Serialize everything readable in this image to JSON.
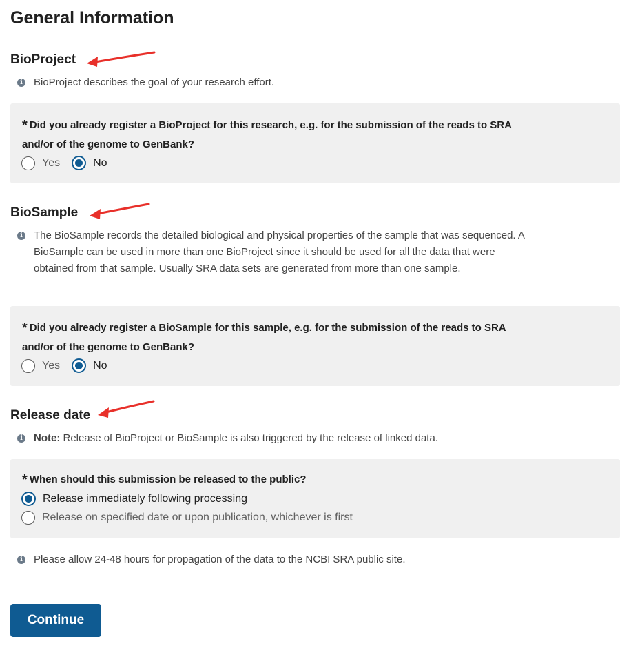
{
  "page_title": "General Information",
  "colors": {
    "accent": "#0f5b92",
    "panel_bg": "#f0f0f0",
    "annotation_arrow": "#e8302a"
  },
  "bioproject": {
    "heading": "BioProject",
    "info": "BioProject describes the goal of your research effort.",
    "question": "Did you already register a BioProject for this research, e.g. for the submission of the reads to SRA and/or of the genome to GenBank?",
    "options": [
      {
        "label": "Yes",
        "selected": false
      },
      {
        "label": "No",
        "selected": true
      }
    ]
  },
  "biosample": {
    "heading": "BioSample",
    "info": "The BioSample records the detailed biological and physical properties of the sample that was sequenced. A BioSample can be used in more than one BioProject since it should be used for all the data that were obtained from that sample. Usually SRA data sets are generated from more than one sample.",
    "question": "Did you already register a BioSample for this sample, e.g. for the submission of the reads to SRA and/or of the genome to GenBank?",
    "options": [
      {
        "label": "Yes",
        "selected": false
      },
      {
        "label": "No",
        "selected": true
      }
    ]
  },
  "release_date": {
    "heading": "Release date",
    "note_label": "Note:",
    "note_text": " Release of BioProject or BioSample is also triggered by the release of linked data.",
    "question": "When should this submission be released to the public?",
    "options": [
      {
        "label": "Release immediately following processing",
        "selected": true
      },
      {
        "label": "Release on specified date or upon publication, whichever is first",
        "selected": false
      }
    ]
  },
  "propagation_info": "Please allow 24-48 hours for propagation of the data to the NCBI SRA public site.",
  "continue_label": "Continue",
  "icons": {
    "info": "info-circle-icon",
    "required": "asterisk-icon",
    "annotation": "red-arrow-icon"
  }
}
